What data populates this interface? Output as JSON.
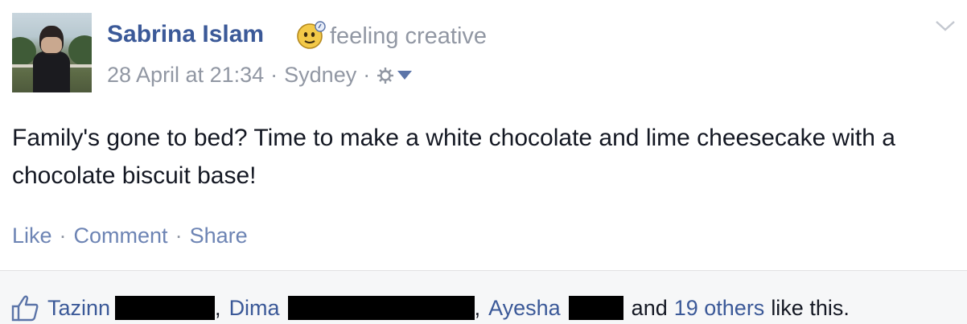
{
  "post": {
    "author": "Sabrina Islam",
    "feeling": "feeling creative",
    "feeling_icon": "emoticon-creative-icon",
    "date": "28 April at 21:34",
    "meta_sep": "·",
    "location": "Sydney",
    "privacy_icon": "gear-icon",
    "message": "Family's gone to bed? Time to make a white chocolate and lime cheesecake with a chocolate biscuit base!"
  },
  "actions": {
    "like": "Like",
    "comment": "Comment",
    "share": "Share",
    "separator": "·"
  },
  "likes": {
    "icon": "thumbs-up-icon",
    "likers": [
      "Tazinn",
      "Dima",
      "Ayesha"
    ],
    "comma": ",",
    "and_text": "and",
    "others": "19 others",
    "suffix": "like this."
  },
  "colors": {
    "link": "#3b5998",
    "muted": "#9197a3",
    "action_link": "#6d84b4",
    "likes_bg": "#f6f7f8"
  }
}
